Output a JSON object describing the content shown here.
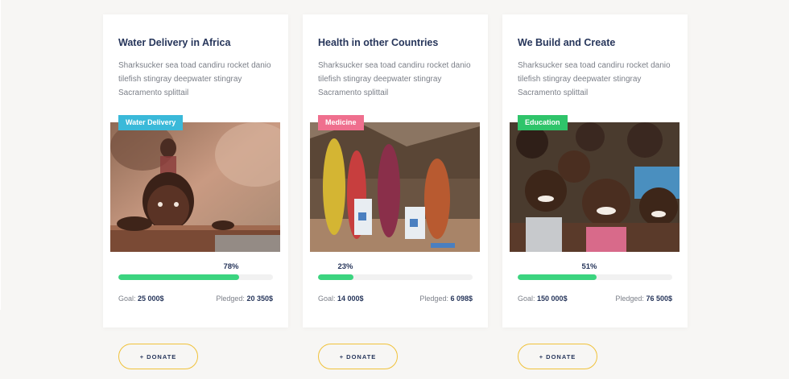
{
  "cards": [
    {
      "title": "Water Delivery in Africa",
      "description": "Sharksucker sea toad candiru rocket danio tilefish stingray deepwater stingray Sacramento splittail",
      "tag": "Water Delivery",
      "tag_color": "#3ab9d9",
      "photo": "child-leaning-on-fence",
      "progress": 78,
      "progress_label": "78%",
      "goal_label": "Goal:",
      "goal_value": "25 000$",
      "pledged_label": "Pledged:",
      "pledged_value": "20 350$",
      "donate_label": "+ DONATE"
    },
    {
      "title": "Health in other Countries",
      "description": "Sharksucker sea toad candiru rocket danio tilefish stingray deepwater stingray Sacramento splittail",
      "tag": "Medicine",
      "tag_color": "#ef6f8e",
      "photo": "women-with-aid-sacks",
      "progress": 23,
      "progress_label": "23%",
      "goal_label": "Goal:",
      "goal_value": "14 000$",
      "pledged_label": "Pledged:",
      "pledged_value": "6 098$",
      "donate_label": "+ DONATE"
    },
    {
      "title": "We Build and Create",
      "description": "Sharksucker sea toad candiru rocket danio tilefish stingray deepwater stingray Sacramento splittail",
      "tag": "Education",
      "tag_color": "#2fc46a",
      "photo": "group-of-smiling-children",
      "progress": 51,
      "progress_label": "51%",
      "goal_label": "Goal:",
      "goal_value": "150 000$",
      "pledged_label": "Pledged:",
      "pledged_value": "76 500$",
      "donate_label": "+ DONATE"
    }
  ]
}
